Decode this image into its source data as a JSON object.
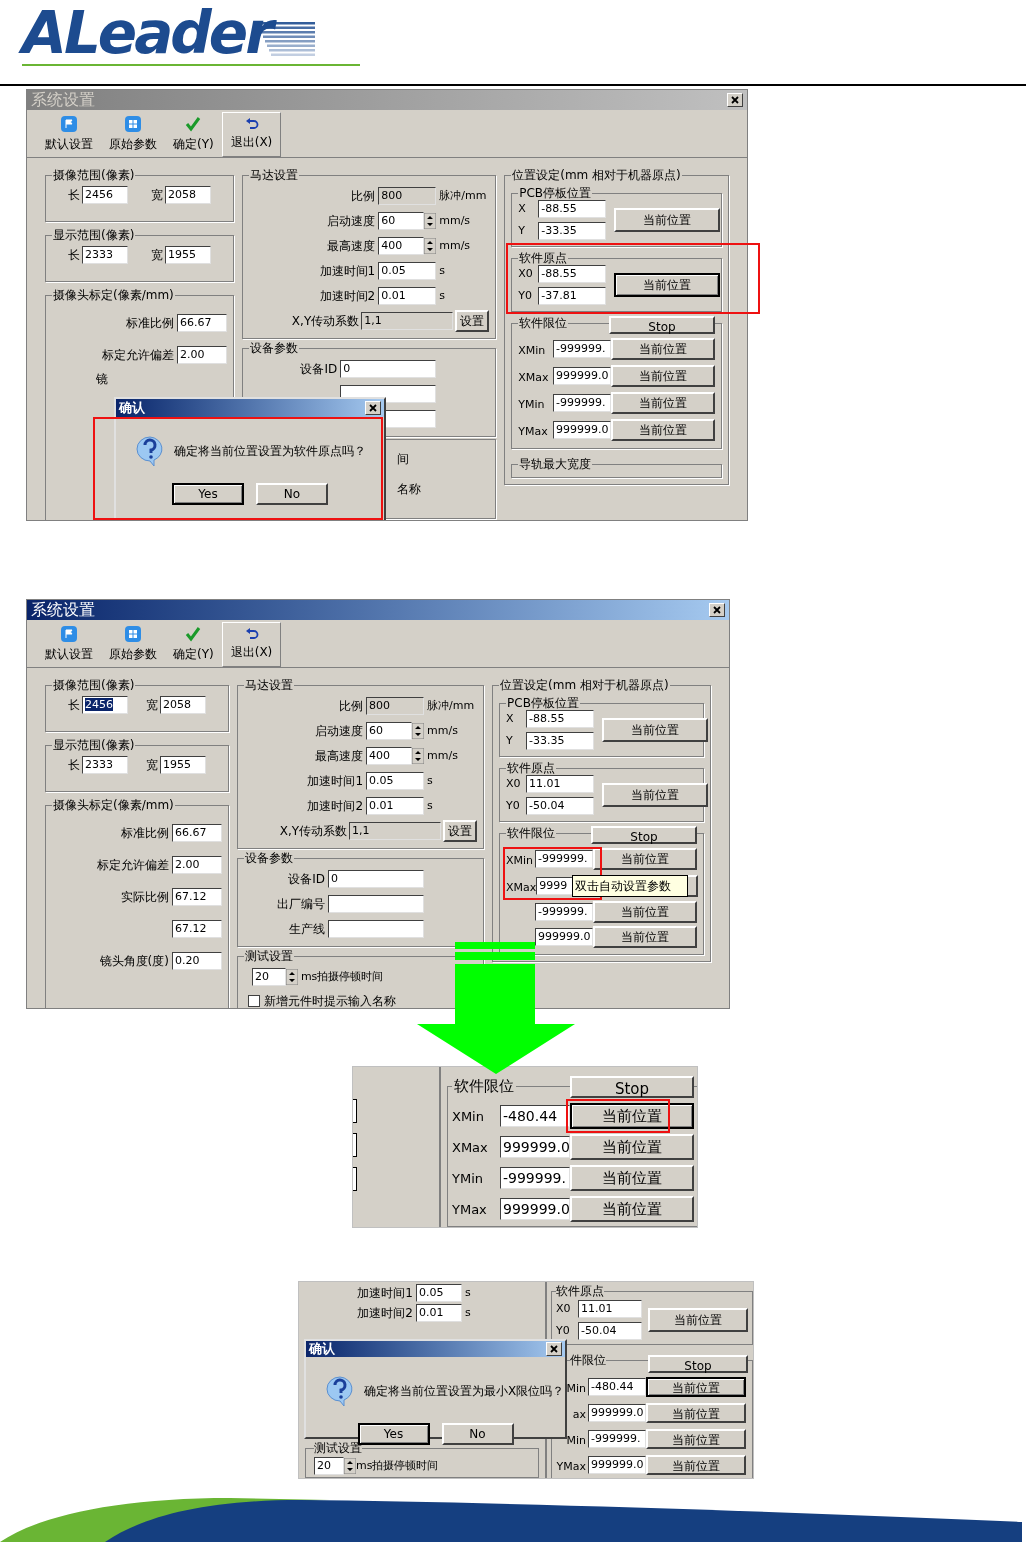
{
  "header": {
    "logo": "ALeader"
  },
  "screenshots": [
    {
      "kind": "window",
      "title": "系统设置",
      "active": false,
      "toolbar": [
        {
          "label": "默认设置"
        },
        {
          "label": "原始参数"
        },
        {
          "label": "确定(Y)"
        },
        {
          "label": "退出(X)"
        }
      ],
      "left": [
        {
          "title": "摄像范围(像素)",
          "rows": [
            {
              "kind": "pair",
              "items": [
                {
                  "label": "长",
                  "value": "2456",
                  "selected": false
                },
                {
                  "label": "宽",
                  "value": "2058",
                  "selected": false
                }
              ]
            }
          ]
        },
        {
          "title": "显示范围(像素)",
          "rows": [
            {
              "kind": "pair",
              "items": [
                {
                  "label": "长",
                  "value": "2333",
                  "selected": false
                },
                {
                  "label": "宽",
                  "value": "1955",
                  "selected": false
                }
              ]
            }
          ]
        },
        {
          "title": "摄像头标定(像素/mm)",
          "rows": [
            {
              "kind": "field",
              "label": "标准比例",
              "value": "66.67"
            },
            {
              "kind": "field",
              "label": "标定允许偏差",
              "value": "2.00"
            },
            {
              "kind": "text",
              "text": "镜"
            }
          ]
        }
      ],
      "middle": [
        {
          "title": "马达设置",
          "rows": [
            {
              "kind": "field",
              "label": "比例",
              "value": "800",
              "unit": "脉冲/mm",
              "disabled": true
            },
            {
              "kind": "spin",
              "label": "启动速度",
              "value": "60",
              "unit": "mm/s",
              "disabled": false
            },
            {
              "kind": "spin",
              "label": "最高速度",
              "value": "400",
              "unit": "mm/s",
              "disabled": false
            },
            {
              "kind": "field",
              "label": "加速时间1",
              "value": "0.05",
              "unit": "s",
              "disabled": false
            },
            {
              "kind": "field",
              "label": "加速时间2",
              "value": "0.01",
              "unit": "s",
              "disabled": false
            },
            {
              "kind": "button_field",
              "label": "X,Y传动系数",
              "value": "1,1",
              "button": "设置",
              "disabled": true
            }
          ]
        },
        {
          "title": "设备参数",
          "rows": [
            {
              "kind": "field",
              "label": "设备ID",
              "value": "0"
            },
            {
              "kind": "field"
            },
            {
              "kind": "field"
            }
          ]
        },
        {
          "rows": [
            {
              "kind": "text",
              "text": "间"
            },
            {
              "kind": "text",
              "text": "名称"
            }
          ]
        }
      ],
      "right": {
        "title": "位置设定(mm 相对于机器原点)",
        "groups": [
          {
            "kind": "coords",
            "title": "PCB停板位置",
            "fields": [
              {
                "label": "X",
                "value": "-88.55"
              },
              {
                "label": "Y",
                "value": "-33.35"
              }
            ],
            "button": "当前位置",
            "focused": false
          },
          {
            "kind": "coords",
            "title": "软件原点",
            "fields": [
              {
                "label": "X0",
                "value": "-88.55"
              },
              {
                "label": "Y0",
                "value": "-37.81"
              }
            ],
            "button": "当前位置",
            "focused": true
          },
          {
            "kind": "limits",
            "title": "软件限位",
            "stop": "Stop",
            "rows": [
              {
                "label": "XMin",
                "value": "-999999.",
                "button": "当前位置",
                "focused": false
              },
              {
                "label": "XMax",
                "value": "999999.0",
                "button": "当前位置",
                "focused": false
              },
              {
                "label": "YMin",
                "value": "-999999.",
                "button": "当前位置",
                "focused": false
              },
              {
                "label": "YMax",
                "value": "999999.0",
                "button": "当前位置",
                "focused": false
              }
            ]
          },
          {
            "kind": "cut",
            "title": "导轨最大宽度"
          }
        ]
      },
      "dialog": {
        "title": "确认",
        "message": "确定将当前位置设置为软件原点吗？",
        "buttons": [
          {
            "label": "Yes",
            "focused": true
          },
          {
            "label": "No",
            "focused": false
          }
        ]
      }
    },
    {
      "kind": "window",
      "title": "系统设置",
      "active": true,
      "toolbar": [
        {
          "label": "默认设置"
        },
        {
          "label": "原始参数"
        },
        {
          "label": "确定(Y)"
        },
        {
          "label": "退出(X)"
        }
      ],
      "left": [
        {
          "title": "摄像范围(像素)",
          "rows": [
            {
              "kind": "pair",
              "items": [
                {
                  "label": "长",
                  "value": "2456",
                  "selected": true
                },
                {
                  "label": "宽",
                  "value": "2058",
                  "selected": false
                }
              ]
            }
          ]
        },
        {
          "title": "显示范围(像素)",
          "rows": [
            {
              "kind": "pair",
              "items": [
                {
                  "label": "长",
                  "value": "2333",
                  "selected": false
                },
                {
                  "label": "宽",
                  "value": "1955",
                  "selected": false
                }
              ]
            }
          ]
        },
        {
          "title": "摄像头标定(像素/mm)",
          "rows": [
            {
              "kind": "field",
              "label": "标准比例",
              "value": "66.67"
            },
            {
              "kind": "field",
              "label": "标定允许偏差",
              "value": "2.00"
            },
            {
              "kind": "field",
              "label": "实际比例",
              "value": "67.12"
            },
            {
              "kind": "field",
              "value": "67.12"
            },
            {
              "kind": "field",
              "label": "镜头角度(度)",
              "value": "0.20"
            }
          ]
        }
      ],
      "middle": [
        {
          "title": "马达设置",
          "rows": [
            {
              "kind": "field",
              "label": "比例",
              "value": "800",
              "unit": "脉冲/mm",
              "disabled": true
            },
            {
              "kind": "spin",
              "label": "启动速度",
              "value": "60",
              "unit": "mm/s",
              "disabled": false
            },
            {
              "kind": "spin",
              "label": "最高速度",
              "value": "400",
              "unit": "mm/s",
              "disabled": false
            },
            {
              "kind": "field",
              "label": "加速时间1",
              "value": "0.05",
              "unit": "s",
              "disabled": false
            },
            {
              "kind": "field",
              "label": "加速时间2",
              "value": "0.01",
              "unit": "s",
              "disabled": false
            },
            {
              "kind": "button_field",
              "label": "X,Y传动系数",
              "value": "1,1",
              "button": "设置",
              "disabled": true
            }
          ]
        },
        {
          "title": "设备参数",
          "rows": [
            {
              "kind": "field",
              "label": "设备ID",
              "value": "0"
            },
            {
              "kind": "field",
              "label": "出厂编号"
            },
            {
              "kind": "field",
              "label": "生产线"
            }
          ]
        },
        {
          "title": "测试设置",
          "rows": [
            {
              "kind": "spin",
              "value": "20",
              "unit": "ms拍摄停顿时间"
            },
            {
              "kind": "check",
              "label": "新增元件时提示输入名称",
              "checked": false
            }
          ]
        }
      ],
      "right": {
        "title": "位置设定(mm 相对于机器原点)",
        "groups": [
          {
            "kind": "coords",
            "title": "PCB停板位置",
            "fields": [
              {
                "label": "X",
                "value": "-88.55"
              },
              {
                "label": "Y",
                "value": "-33.35"
              }
            ],
            "button": "当前位置",
            "focused": false
          },
          {
            "kind": "coords",
            "title": "软件原点",
            "fields": [
              {
                "label": "X0",
                "value": "11.01"
              },
              {
                "label": "Y0",
                "value": "-50.04"
              }
            ],
            "button": "当前位置",
            "focused": false
          },
          {
            "kind": "limits",
            "title": "软件限位",
            "stop": "Stop",
            "rows": [
              {
                "label": "XMin",
                "value": "-999999.",
                "button": "当前位置",
                "focused": false
              },
              {
                "label": "XMax",
                "value": "9999"
              },
              {
                "value": "-999999.",
                "button": "当前位置",
                "focused": false
              },
              {
                "value": "999999.0",
                "button": "当前位置",
                "focused": false
              }
            ]
          }
        ]
      },
      "tooltip": "双击自动设置参数"
    },
    {
      "kind": "limits_crop",
      "title": "软件限位",
      "stop": "Stop",
      "rows": [
        {
          "label": "XMin",
          "value": "-480.44",
          "button": "当前位置",
          "focused": true
        },
        {
          "label": "XMax",
          "value": "999999.0",
          "button": "当前位置",
          "focused": false
        },
        {
          "label": "YMin",
          "value": "-999999.",
          "button": "当前位置",
          "focused": false
        },
        {
          "label": "YMax",
          "value": "999999.0",
          "button": "当前位置",
          "focused": false
        }
      ]
    },
    {
      "kind": "partial",
      "rows": [
        {
          "label": "加速时间1",
          "value": "0.05",
          "unit": "s"
        },
        {
          "label": "加速时间2",
          "value": "0.01",
          "unit": "s"
        }
      ],
      "test": {
        "title": "测试设置",
        "value": "20",
        "unit": "ms拍摄停顿时间"
      },
      "origin": {
        "title": "软件原点",
        "fields": [
          {
            "label": "X0",
            "value": "11.01"
          },
          {
            "label": "Y0",
            "value": "-50.04"
          }
        ],
        "button": "当前位置"
      },
      "limits": {
        "title": "件限位",
        "stop": "Stop",
        "rows": [
          {
            "label": "Min",
            "value": "-480.44",
            "button": "当前位置",
            "focused": true
          },
          {
            "label": "ax",
            "value": "999999.0",
            "button": "当前位置",
            "focused": false
          },
          {
            "label": "Min",
            "value": "-999999.",
            "button": "当前位置",
            "focused": false
          },
          {
            "label": "YMax",
            "value": "999999.0",
            "button": "当前位置",
            "focused": false
          }
        ]
      },
      "dialog": {
        "title": "确认",
        "message": "确定将当前位置设置为最小X限位吗？",
        "buttons": [
          {
            "label": "Yes",
            "focused": true
          },
          {
            "label": "No",
            "focused": false
          }
        ]
      }
    }
  ]
}
